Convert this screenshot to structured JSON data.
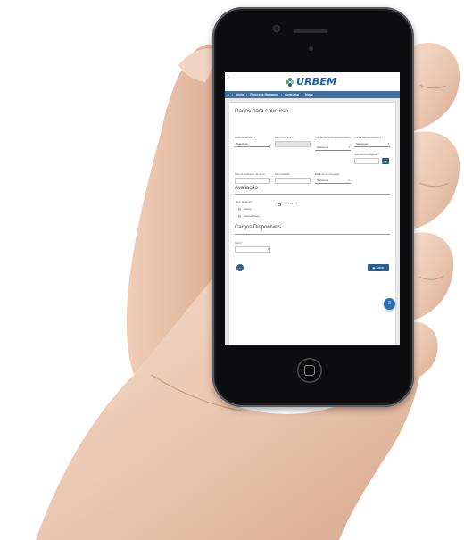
{
  "app": {
    "logo_text": "URBEM"
  },
  "breadcrumb": [
    "Início",
    "Recursos Humanos",
    "Concurso",
    "Novo"
  ],
  "form": {
    "title": "Dados para concurso",
    "fields_row1": [
      {
        "label": "Edital de abertura *",
        "value": "Selecione"
      },
      {
        "label": "Data Publicação *",
        "value": ""
      },
      {
        "label": "Tipo de Norma Regulamentadora *",
        "value": "Selecione"
      },
      {
        "label": "Norma Regulamentadora *",
        "value": "Selecione"
      }
    ],
    "homologation_label": "Data da homologação *",
    "fields_row2": [
      {
        "label": "Data de realização da prova",
        "value": ""
      },
      {
        "label": "Data Validade",
        "value": ""
      },
      {
        "label": "Edital de homologação",
        "value": "Selecione"
      }
    ]
  },
  "evaluation": {
    "title": "Avaliação",
    "type_label": "Tipo de Prova *",
    "options": [
      "Teórica",
      "Teórica/Prática"
    ],
    "exam_checkbox_label": "Avalia Títulos"
  },
  "positions": {
    "title": "Cargos Disponíveis",
    "field_label": "Cargo *",
    "field_value": ""
  },
  "actions": {
    "save_label": "Salvar"
  },
  "icons": {
    "back": "arrow-left-icon",
    "save": "floppy-icon",
    "fab": "menu-icon",
    "logo": "urbem-leaf-icon"
  },
  "colors": {
    "brand_blue": "#1b5fa8",
    "nav_bar": "#3f6f9f",
    "button": "#2a5d91"
  }
}
